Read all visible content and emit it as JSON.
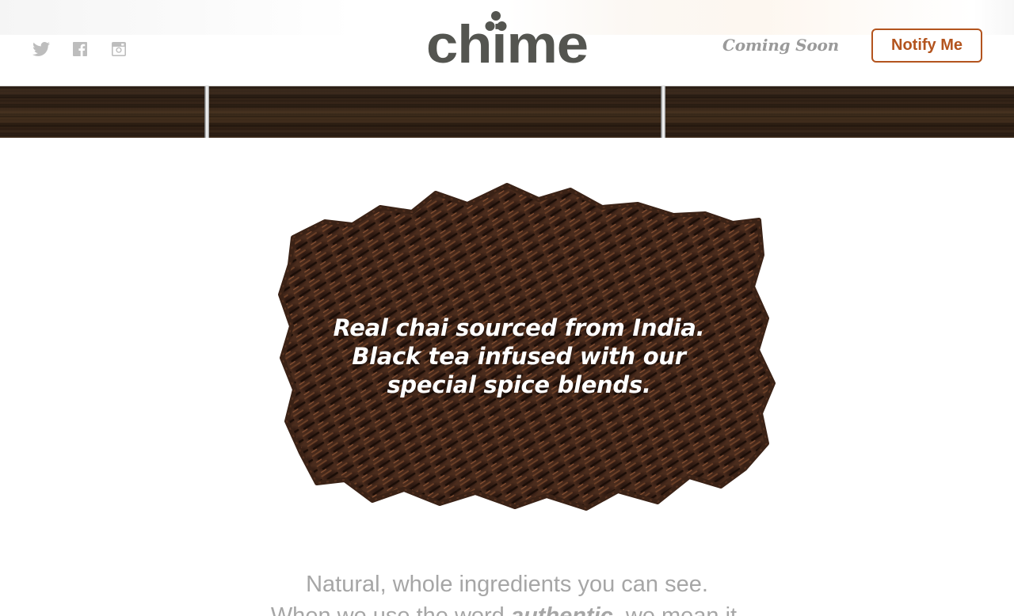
{
  "header": {
    "brand": "chime",
    "coming_soon": "Coming Soon",
    "notify_label": "Notify Me",
    "social": [
      {
        "icon": "twitter-icon"
      },
      {
        "icon": "facebook-icon"
      },
      {
        "icon": "instagram-icon"
      }
    ]
  },
  "hero": {
    "line1": "Real chai sourced from India.",
    "line2": "Black tea infused with our",
    "line3": "special spice blends."
  },
  "intro": {
    "line1": "Natural, whole ingredients you can see.",
    "line2_prefix": "When we use the word ",
    "line2_emphasis": "authentic",
    "line2_suffix": ", we mean it."
  },
  "colors": {
    "accent": "#b3541e",
    "logo": "#545550",
    "muted_text": "#a6a6a6",
    "coming_soon": "#9a9a9a"
  }
}
